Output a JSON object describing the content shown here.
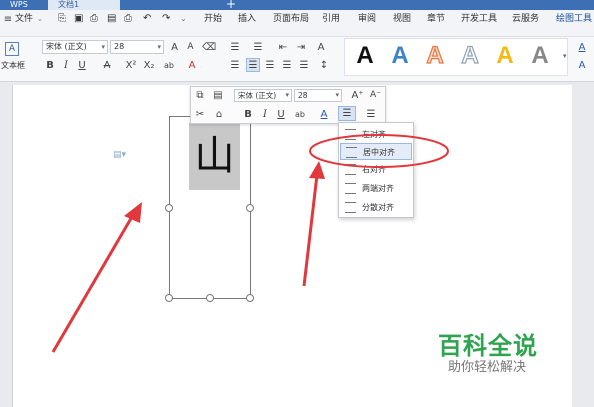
{
  "tabs": {
    "app": "WPS",
    "doc": "文档1",
    "add": "+"
  },
  "menubar": {
    "file": "文件",
    "items": [
      "开始",
      "插入",
      "页面布局",
      "引用",
      "审阅",
      "视图",
      "章节",
      "开发工具",
      "云服务",
      "绘图工具"
    ]
  },
  "ribbon": {
    "textbox_label": "文本框",
    "font_name": "宋体 (正文)",
    "font_size": "28",
    "bold": "B",
    "italic": "I",
    "underline": "U",
    "styles": [
      "A",
      "A",
      "A",
      "A",
      "A",
      "A"
    ]
  },
  "document": {
    "character": "山"
  },
  "mini_toolbar": {
    "font_name": "宋体 (正文)",
    "font_size": "28",
    "grow": "A⁺",
    "shrink": "A⁻",
    "bold": "B",
    "italic": "I",
    "underline": "U",
    "strike": "ab"
  },
  "align_menu": {
    "items": [
      {
        "label": "左对齐"
      },
      {
        "label": "居中对齐",
        "selected": true
      },
      {
        "label": "右对齐"
      },
      {
        "label": "两端对齐"
      },
      {
        "label": "分散对齐"
      }
    ]
  },
  "watermark": {
    "title": "百科全说",
    "subtitle": "助你轻松解决"
  },
  "colors": {
    "accent": "#3d6fb4",
    "arrow": "#e0383c",
    "watermark": "#2fa34f"
  }
}
